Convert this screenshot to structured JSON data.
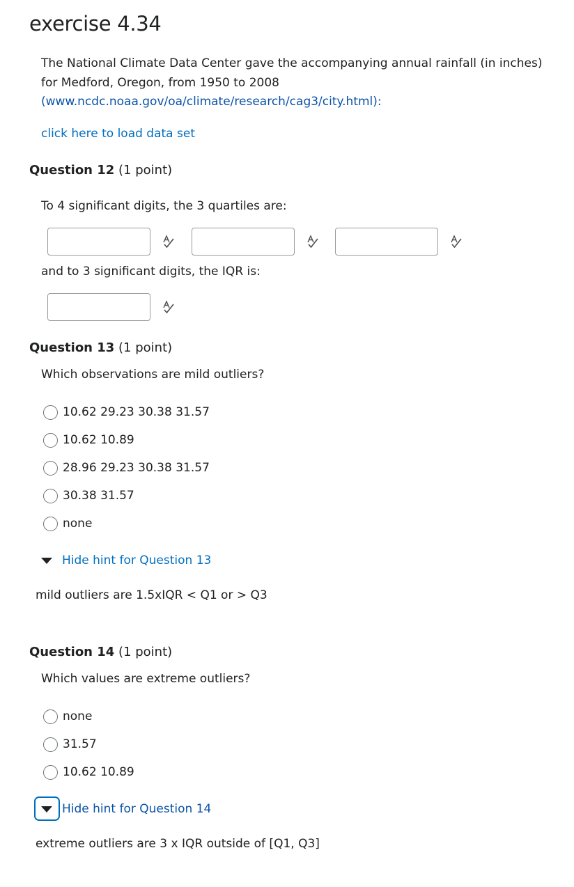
{
  "exercise": {
    "title": "exercise 4.34",
    "intro_text": "The National Climate Data Center gave the accompanying annual rainfall (in inches) for Medford, Oregon, from 1950 to 2008",
    "source_link": "(www.ncdc.noaa.gov/oa/climate/research/cag3/city.html):",
    "dataset_link": "click here to load data set"
  },
  "q12": {
    "number": "Question 12",
    "points": "(1 point)",
    "prompt": "To 4 significant digits, the 3 quartiles are:",
    "prompt2": "and to 3 significant digits, the IQR is:",
    "inputs": [
      "",
      "",
      ""
    ],
    "iqr_input": ""
  },
  "q13": {
    "number": "Question 13",
    "points": "(1 point)",
    "prompt": "Which observations are mild outliers?",
    "options": [
      "10.62 29.23 30.38 31.57",
      "10.62 10.89",
      "28.96 29.23 30.38 31.57",
      "30.38 31.57",
      "none"
    ],
    "hint_toggle": "Hide hint for Question 13",
    "hint_text": "mild outliers are 1.5xIQR < Q1 or > Q3"
  },
  "q14": {
    "number": "Question 14",
    "points": "(1 point)",
    "prompt": "Which values are extreme outliers?",
    "options": [
      "none",
      "31.57",
      "10.62 10.89"
    ],
    "hint_toggle": "Hide hint for Question 14",
    "hint_text": "extreme outliers are 3 x IQR outside of [Q1, Q3]"
  },
  "icons": {
    "spellcheck": "spellcheck-icon",
    "hint_toggle": "triangle-down-icon"
  },
  "colors": {
    "link": "#006fbf",
    "text": "#202122",
    "focus": "#006fbf"
  }
}
